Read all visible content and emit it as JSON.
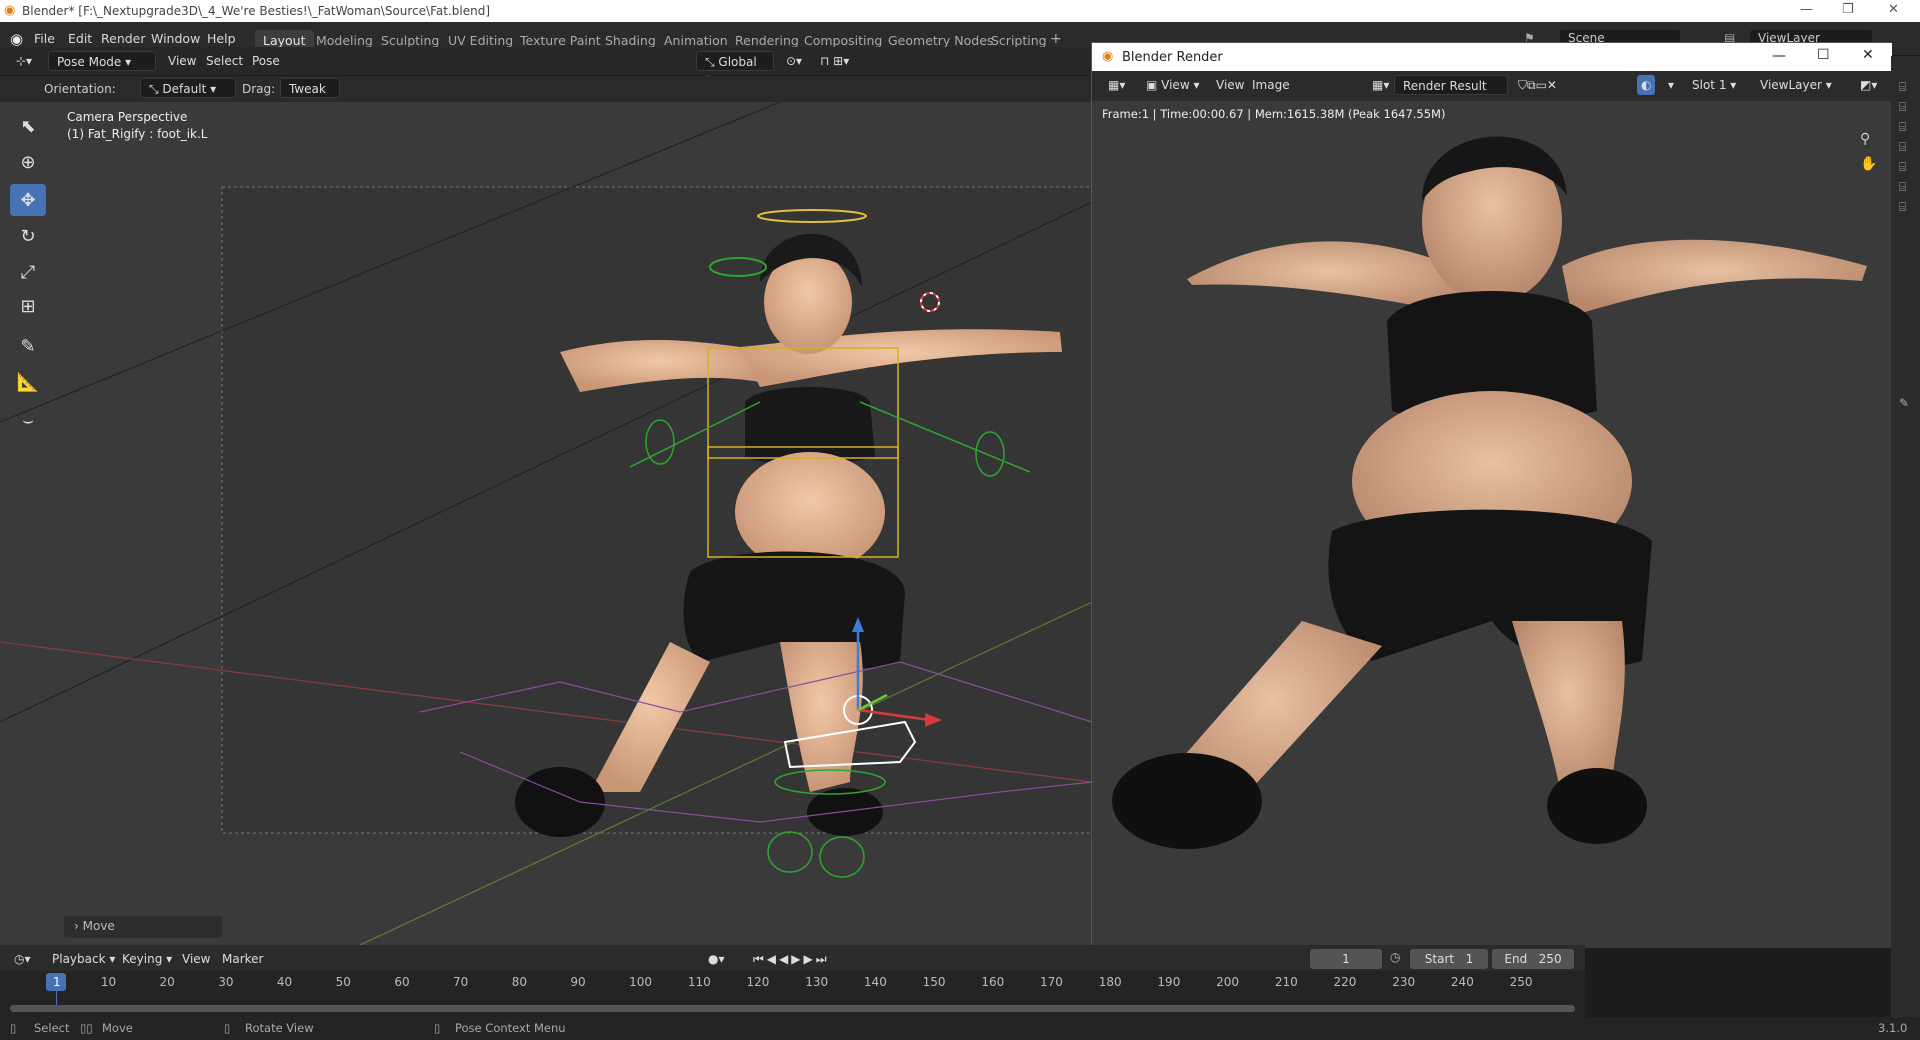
{
  "titlebar": {
    "title": "Blender* [F:\\_Nextupgrade3D\\_4_We're Besties!\\_FatWoman\\Source\\Fat.blend]"
  },
  "menu": [
    "File",
    "Edit",
    "Render",
    "Window",
    "Help"
  ],
  "workspaces": [
    "Layout",
    "Modeling",
    "Sculpting",
    "UV Editing",
    "Texture Paint",
    "Shading",
    "Animation",
    "Rendering",
    "Compositing",
    "Geometry Nodes",
    "Scripting"
  ],
  "scene": {
    "scene_label": "Scene",
    "viewlayer_label": "ViewLayer"
  },
  "viewport_header": {
    "mode": "Pose Mode",
    "view": "View",
    "select": "Select",
    "pose": "Pose",
    "transform": "Global"
  },
  "tool_settings": {
    "orientation_label": "Orientation:",
    "orientation_value": "Default",
    "drag_label": "Drag:",
    "drag_value": "Tweak"
  },
  "viewport": {
    "camera_text": "Camera Perspective",
    "object_text": "(1) Fat_Rigify : foot_ik.L",
    "last_op": "Move"
  },
  "render_window": {
    "title": "Blender Render",
    "view1": "View",
    "view2": "View",
    "image": "Image",
    "image_name": "Render Result",
    "slot": "Slot 1",
    "viewlayer": "ViewLayer",
    "stats": "Frame:1 | Time:00:00.67 | Mem:1615.38M (Peak 1647.55M)"
  },
  "timeline": {
    "playback": "Playback",
    "keying": "Keying",
    "view": "View",
    "marker": "Marker",
    "current_frame": "1",
    "start_label": "Start",
    "start": "1",
    "end_label": "End",
    "end": "250",
    "frames": [
      "1",
      "10",
      "20",
      "30",
      "40",
      "50",
      "60",
      "70",
      "80",
      "90",
      "100",
      "110",
      "120",
      "130",
      "140",
      "150",
      "160",
      "170",
      "180",
      "190",
      "200",
      "210",
      "220",
      "230",
      "240",
      "250"
    ]
  },
  "statusbar": {
    "select": "Select",
    "move": "Move",
    "rotate": "Rotate View",
    "context": "Pose Context Menu",
    "version": "3.1.0"
  },
  "colors": {
    "accent": "#4772b3",
    "viewport_bg": "#393939",
    "header": "#2b2b2b"
  }
}
